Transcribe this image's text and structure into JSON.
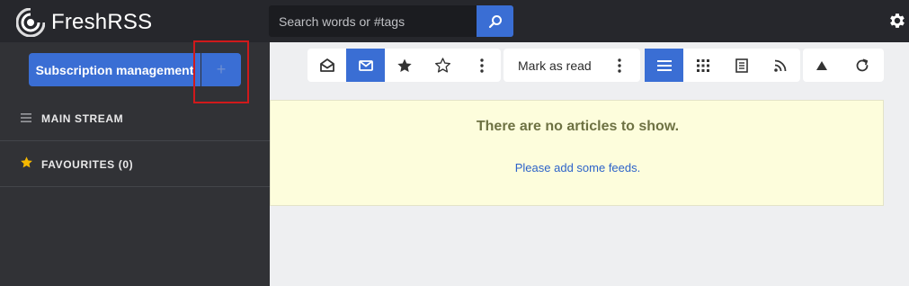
{
  "app": {
    "title": "FreshRSS"
  },
  "search": {
    "placeholder": "Search words or #tags"
  },
  "sidebar": {
    "subscription_label": "Subscription management",
    "add_label": "+",
    "items": [
      {
        "label": "MAIN STREAM",
        "icon": "list-icon"
      },
      {
        "label": "FAVOURITES (0)",
        "icon": "star-icon"
      }
    ]
  },
  "toolbar": {
    "mark_read_label": "Mark as read",
    "buttons": [
      "read-icon",
      "unread-icon",
      "starred-icon",
      "unstarred-icon",
      "more-icon",
      "more-icon",
      "normal-view-icon",
      "grid-view-icon",
      "reader-view-icon",
      "rss-icon",
      "scroll-up-icon",
      "refresh-icon"
    ]
  },
  "notice": {
    "title": "There are no articles to show.",
    "link": "Please add some feeds."
  },
  "colors": {
    "accent": "#3a6ed4",
    "topbar": "#26272c",
    "sidebar": "#313236",
    "notice_bg": "#fdfddc",
    "highlight": "#d0191b"
  }
}
